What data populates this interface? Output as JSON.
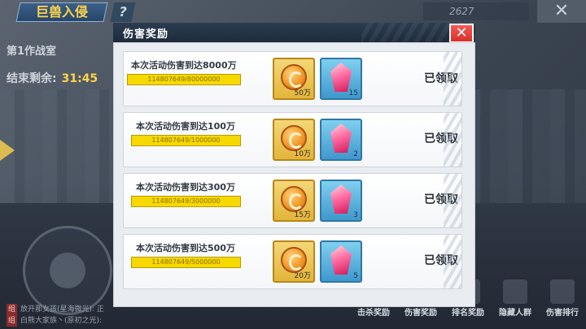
{
  "background": {
    "game_title": "巨兽入侵",
    "help": "?",
    "score": "2627",
    "room_title": "第1作战室",
    "countdown_label": "结束剩余:",
    "countdown_value": "31:45",
    "chat": [
      {
        "tag": "组",
        "text": "放开那女孩(星海微光): 正"
      },
      {
        "tag": "组",
        "text": "白熊大家族丶(原初之光):"
      }
    ],
    "bottom_nav": [
      {
        "label": "击杀奖励"
      },
      {
        "label": "伤害奖励"
      },
      {
        "label": "排名奖励"
      },
      {
        "label": "隐藏人群"
      },
      {
        "label": "伤害排行"
      }
    ]
  },
  "modal": {
    "title": "伤害奖励",
    "close_icon": "close-icon",
    "rewards": [
      {
        "desc": "本次活动伤害到达8000万",
        "progress": "114807649/80000000",
        "fraction": 1.0,
        "items": [
          {
            "icon": "coin-icon",
            "qty": "50万"
          },
          {
            "icon": "crystal-icon",
            "qty": "15"
          }
        ],
        "status": "已领取"
      },
      {
        "desc": "本次活动伤害到达100万",
        "progress": "114807649/1000000",
        "fraction": 1.0,
        "items": [
          {
            "icon": "coin-icon",
            "qty": "10万"
          },
          {
            "icon": "crystal-icon",
            "qty": "2"
          }
        ],
        "status": "已领取"
      },
      {
        "desc": "本次活动伤害到达300万",
        "progress": "114807649/3000000",
        "fraction": 1.0,
        "items": [
          {
            "icon": "coin-icon",
            "qty": "15万"
          },
          {
            "icon": "crystal-icon",
            "qty": "3"
          }
        ],
        "status": "已领取"
      },
      {
        "desc": "本次活动伤害到达500万",
        "progress": "114807649/5000000",
        "fraction": 1.0,
        "items": [
          {
            "icon": "coin-icon",
            "qty": "20万"
          },
          {
            "icon": "crystal-icon",
            "qty": "5"
          }
        ],
        "status": "已领取"
      }
    ]
  }
}
